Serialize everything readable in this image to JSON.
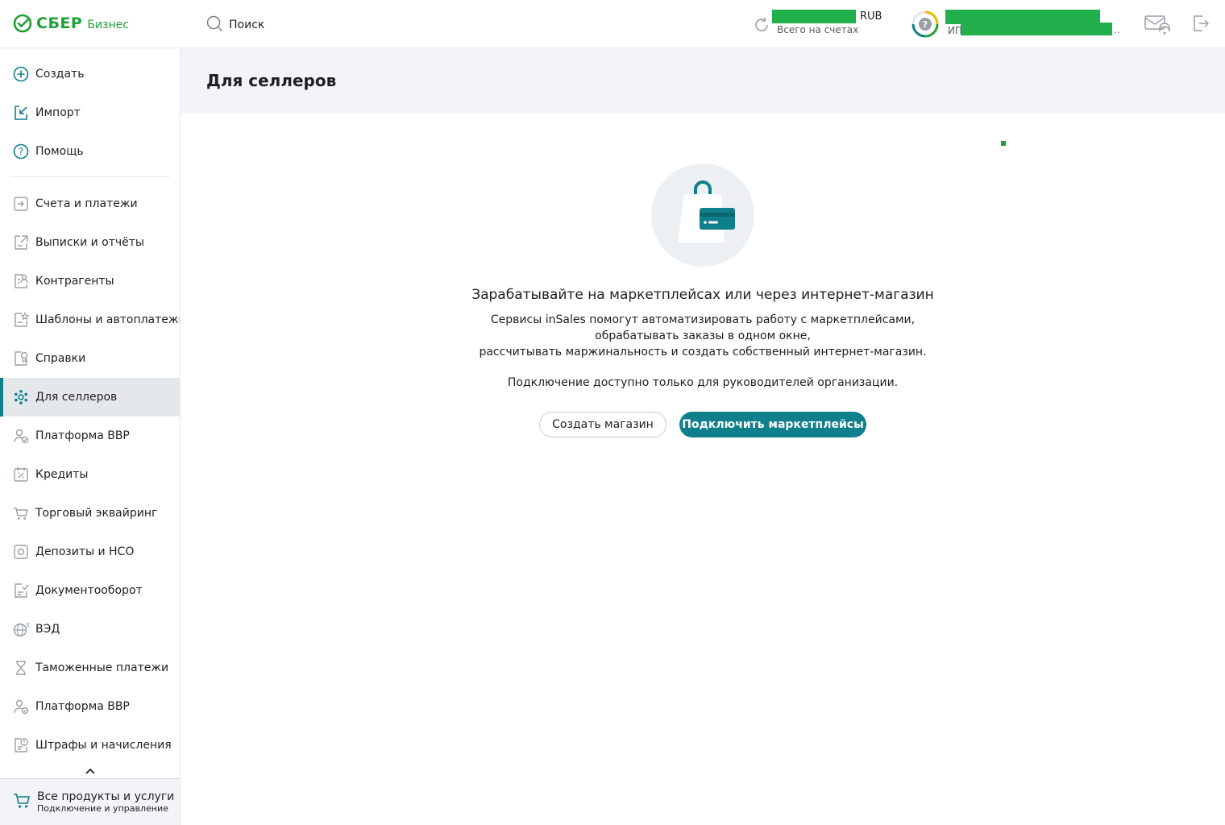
{
  "header": {
    "logo": {
      "brand": "СБЕР",
      "product": "Бизнес"
    },
    "search": {
      "label": "Поиск"
    },
    "balance": {
      "currency": "RUB",
      "caption": "Всего на счетах"
    },
    "org": {
      "type": "ИП",
      "ellipsis": ".."
    },
    "colors": {
      "brand_green": "#21a038",
      "redaction": "#21b04b"
    }
  },
  "sidebar": {
    "top_items": [
      {
        "label": "Создать",
        "icon": "plus-circle-icon"
      },
      {
        "label": "Импорт",
        "icon": "import-icon"
      },
      {
        "label": "Помощь",
        "icon": "help-circle-icon"
      }
    ],
    "items": [
      {
        "label": "Счета и платежи",
        "icon": "payments-icon"
      },
      {
        "label": "Выписки и отчёты",
        "icon": "statements-icon"
      },
      {
        "label": "Контрагенты",
        "icon": "counterparties-icon"
      },
      {
        "label": "Шаблоны и автоплатежи",
        "icon": "templates-icon"
      },
      {
        "label": "Справки",
        "icon": "certificates-icon"
      },
      {
        "label": "Для селлеров",
        "icon": "sellers-icon",
        "active": true
      },
      {
        "label": "Платформа ВВР",
        "icon": "platform-icon"
      },
      {
        "label": "Кредиты",
        "icon": "credits-icon"
      },
      {
        "label": "Торговый эквайринг",
        "icon": "acquiring-icon"
      },
      {
        "label": "Депозиты и НСО",
        "icon": "deposits-icon"
      },
      {
        "label": "Документооборот",
        "icon": "documents-icon"
      },
      {
        "label": "ВЭД",
        "icon": "globe-icon"
      },
      {
        "label": "Таможенные платежи",
        "icon": "customs-icon"
      },
      {
        "label": "Платформа ВВР",
        "icon": "platform-icon"
      },
      {
        "label": "Штрафы и начисления",
        "icon": "fines-icon"
      }
    ],
    "all_products": {
      "title": "Все продукты и услуги",
      "subtitle": "Подключение и управление",
      "icon": "cart-icon"
    },
    "accent": "#107f8c"
  },
  "main": {
    "page_title": "Для селлеров",
    "illustration": "shopping-bag-card-icon",
    "hero": {
      "title": "Зарабатывайте на маркетплейсах или через интернет-магазин",
      "desc_line1": "Сервисы inSales помогут автоматизировать работу с маркетплейсами,",
      "desc_line2": "обрабатывать заказы в одном окне,",
      "desc_line3": "рассчитывать маржинальность и создать собственный интернет-магазин.",
      "note": "Подключение доступно только для руководителей организации."
    },
    "buttons": {
      "secondary": "Создать магазин",
      "primary": "Подключить маркетплейсы"
    }
  }
}
